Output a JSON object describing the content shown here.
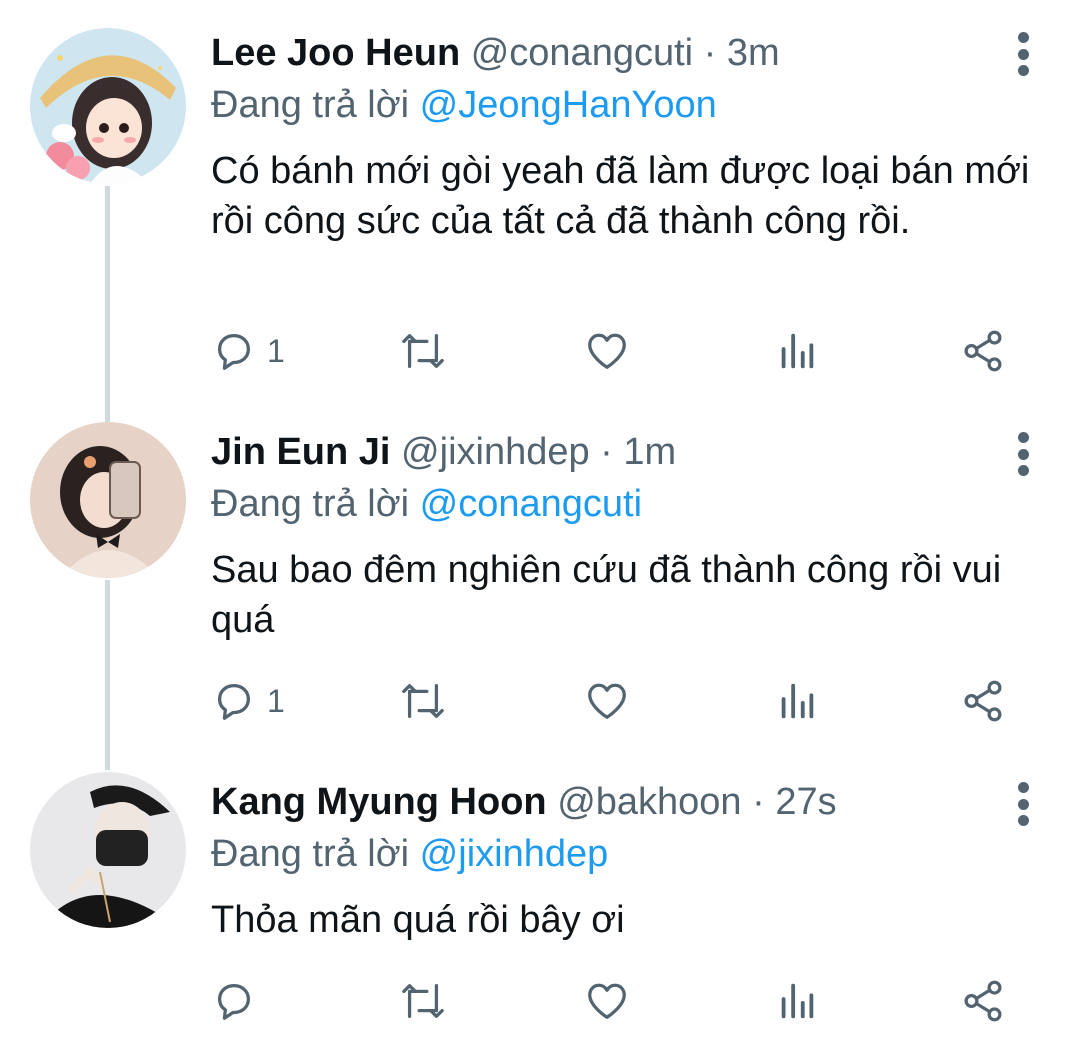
{
  "replying_label": "Đang trả lời",
  "tweets": [
    {
      "name": "Lee Joo Heun",
      "handle": "@conangcuti",
      "time": "3m",
      "replying_to": "@JeongHanYoon",
      "text": "Có bánh mới gòi yeah đã làm được loại bán mới rồi công sức của tất cả đã thành công rồi.",
      "replies": "1"
    },
    {
      "name": "Jin Eun Ji",
      "handle": "@jixinhdep",
      "time": "1m",
      "replying_to": "@conangcuti",
      "text": "Sau bao đêm nghiên cứu đã thành công rồi vui quá",
      "replies": "1"
    },
    {
      "name": "Kang Myung Hoon",
      "handle": "@bakhoon",
      "time": "27s",
      "replying_to": "@jixinhdep",
      "text": "Thỏa mãn quá rồi bây ơi",
      "replies": ""
    }
  ],
  "separator": " · ",
  "colors": {
    "accent": "#1d9bf0",
    "text_primary": "#0f1419",
    "text_secondary": "#536471",
    "thread_line": "#cfd9de"
  },
  "icons": {
    "reply": "reply-icon",
    "retweet": "retweet-icon",
    "like": "heart-icon",
    "views": "analytics-icon",
    "share": "share-icon",
    "more": "more-vertical-icon"
  }
}
